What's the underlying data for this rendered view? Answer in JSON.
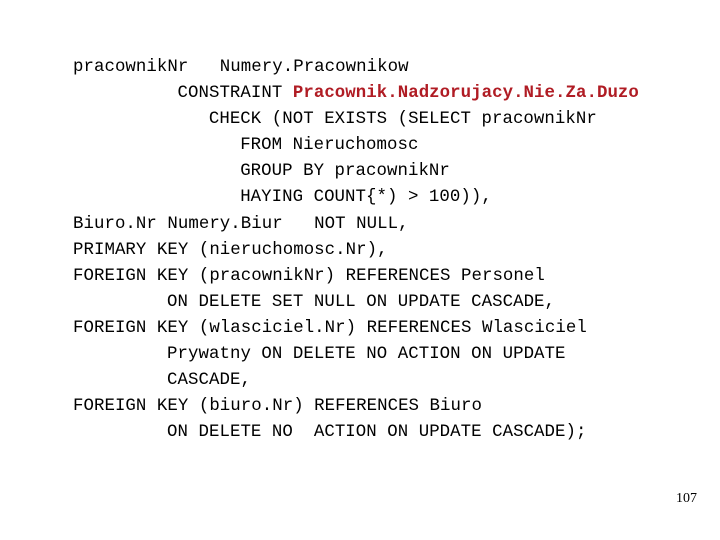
{
  "slide": {
    "page_number": "107",
    "background_color": "#ffffff",
    "text_color": "#000000",
    "accent_color": "#b01c24"
  },
  "code": {
    "lines": [
      {
        "indent": 0,
        "segments": [
          {
            "text": "pracownikNr   Numery.Pracownikow",
            "highlight": false
          }
        ]
      },
      {
        "indent": 10,
        "segments": [
          {
            "text": "CONSTRAINT ",
            "highlight": false
          },
          {
            "text": "Pracownik.Nadzorujacy.Nie.Za.Duzo",
            "highlight": true
          }
        ]
      },
      {
        "indent": 13,
        "segments": [
          {
            "text": "CHECK (NOT EXISTS (SELECT pracownikNr",
            "highlight": false
          }
        ]
      },
      {
        "indent": 16,
        "segments": [
          {
            "text": "FROM Nieruchomosc",
            "highlight": false
          }
        ]
      },
      {
        "indent": 16,
        "segments": [
          {
            "text": "GROUP BY pracownikNr",
            "highlight": false
          }
        ]
      },
      {
        "indent": 16,
        "segments": [
          {
            "text": "HAYING COUNT{*) > 100)),",
            "highlight": false
          }
        ]
      },
      {
        "indent": 0,
        "segments": [
          {
            "text": "Biuro.Nr Numery.Biur   NOT NULL,",
            "highlight": false
          }
        ]
      },
      {
        "indent": 0,
        "segments": [
          {
            "text": "PRIMARY KEY (nieruchomosc.Nr),",
            "highlight": false
          }
        ]
      },
      {
        "indent": 0,
        "segments": [
          {
            "text": "FOREIGN KEY (pracownikNr) REFERENCES Personel",
            "highlight": false
          }
        ]
      },
      {
        "indent": 9,
        "segments": [
          {
            "text": "ON DELETE SET NULL ON UPDATE CASCADE,",
            "highlight": false
          }
        ]
      },
      {
        "indent": 0,
        "segments": [
          {
            "text": "FOREIGN KEY (wlasciciel.Nr) REFERENCES Wlasciciel",
            "highlight": false
          }
        ]
      },
      {
        "indent": 9,
        "segments": [
          {
            "text": "Prywatny ON DELETE NO ACTION ON UPDATE",
            "highlight": false
          }
        ]
      },
      {
        "indent": 9,
        "segments": [
          {
            "text": "CASCADE,",
            "highlight": false
          }
        ]
      },
      {
        "indent": 0,
        "segments": [
          {
            "text": "FOREIGN KEY (biuro.Nr) REFERENCES Biuro",
            "highlight": false
          }
        ]
      },
      {
        "indent": 9,
        "segments": [
          {
            "text": "ON DELETE NO  ACTION ON UPDATE CASCADE);",
            "highlight": false
          }
        ]
      }
    ]
  }
}
